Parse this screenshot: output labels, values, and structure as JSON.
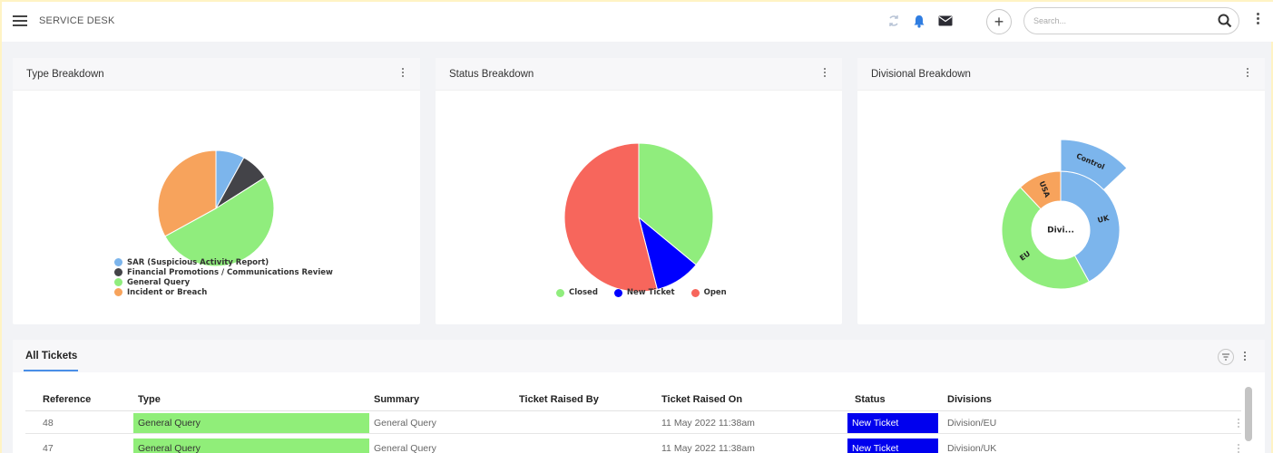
{
  "header": {
    "title": "SERVICE DESK",
    "search_placeholder": "Search..."
  },
  "cards": {
    "type": {
      "title": "Type Breakdown"
    },
    "status": {
      "title": "Status Breakdown"
    },
    "divisional": {
      "title": "Divisional Breakdown"
    }
  },
  "chart_data": [
    {
      "type": "pie",
      "title": "Type Breakdown",
      "categories": [
        "SAR (Suspicious Activity Report)",
        "Financial Promotions / Communications Review",
        "General Query",
        "Incident or Breach"
      ],
      "values": [
        8,
        8,
        51,
        33
      ],
      "colors": [
        "#7cb5ec",
        "#434348",
        "#90ed7d",
        "#f7a35c"
      ],
      "legend_position": "bottom"
    },
    {
      "type": "pie",
      "title": "Status Breakdown",
      "categories": [
        "Closed",
        "New Ticket",
        "Open"
      ],
      "values": [
        36,
        10,
        54
      ],
      "colors": [
        "#90ed7d",
        "#0000ff",
        "#f7665c"
      ],
      "legend_position": "bottom"
    },
    {
      "type": "sunburst",
      "title": "Divisional Breakdown",
      "center_label": "Divi...",
      "categories": [
        "UK",
        "EU",
        "USA"
      ],
      "values": [
        42,
        46,
        12
      ],
      "colors": [
        "#7cb5ec",
        "#90ed7d",
        "#f7a35c"
      ],
      "children": [
        {
          "parent": "UK",
          "name": "Control",
          "value": 13
        }
      ]
    }
  ],
  "tickets": {
    "tab_label": "All Tickets",
    "columns": [
      "Reference",
      "Type",
      "Summary",
      "Ticket Raised By",
      "Ticket Raised On",
      "Status",
      "Divisions"
    ],
    "rows": [
      [
        "48",
        "General Query",
        "General Query",
        "",
        "11 May 2022 11:38am",
        "New Ticket",
        "Division/EU"
      ],
      [
        "47",
        "General Query",
        "General Query",
        "",
        "11 May 2022 11:38am",
        "New Ticket",
        "Division/UK"
      ]
    ]
  },
  "colors": {
    "type_cell": "#90ee79",
    "status_new_ticket": "#0000ee",
    "tab_underline": "#4a8fe7"
  },
  "icons": [
    "menu-icon",
    "refresh-icon",
    "bell-icon",
    "mail-icon",
    "plus-icon",
    "search-icon",
    "more-vertical-icon",
    "filter-icon"
  ]
}
